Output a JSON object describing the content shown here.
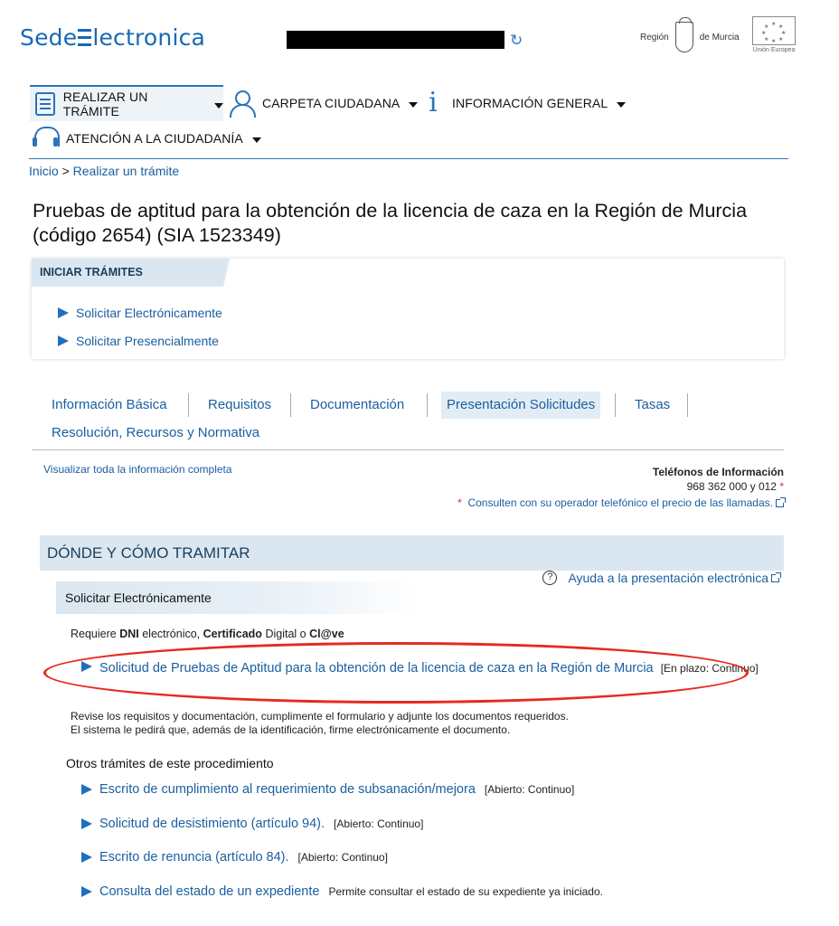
{
  "header": {
    "logo_text_before": "Sede",
    "logo_text_after": "lectronica",
    "region_label_left": "Región",
    "region_label_right": "de Murcia",
    "eu_caption": "Unión Europea"
  },
  "menu": {
    "items": [
      {
        "label": "REALIZAR UN TRÁMITE",
        "icon": "document-check-icon"
      },
      {
        "label": "CARPETA CIUDADANA",
        "icon": "user-icon"
      },
      {
        "label": "INFORMACIÓN GENERAL",
        "icon": "info-icon"
      },
      {
        "label": "ATENCIÓN A LA CIUDADANÍA",
        "icon": "headset-icon"
      }
    ]
  },
  "breadcrumb": {
    "home": "Inicio",
    "separator": ">",
    "current": "Realizar un trámite"
  },
  "page_title": "Pruebas de aptitud para la obtención de la licencia de caza en la Región de Murcia (código 2654) (SIA 1523349)",
  "iniciar": {
    "tab_label": "INICIAR TRÁMITES",
    "links": [
      "Solicitar Electrónicamente",
      "Solicitar Presencialmente"
    ]
  },
  "tabs": {
    "items": [
      "Información Básica",
      "Requisitos",
      "Documentación",
      "Presentación Solicitudes",
      "Tasas",
      "Resolución, Recursos y Normativa"
    ],
    "active": "Presentación Solicitudes"
  },
  "info": {
    "view_all": "Visualizar toda la información completa",
    "phones_title": "Teléfonos de Información",
    "phones": "968 362 000 y 012",
    "asterisk": "*",
    "note": "Consulten con su operador telefónico el precio de las llamadas."
  },
  "section": {
    "title": "DÓNDE Y CÓMO TRAMITAR",
    "help_link": "Ayuda a la presentación electrónica",
    "sub_title": "Solicitar Electrónicamente",
    "requiere_prefix": "Requiere",
    "requiere_dni": "DNI",
    "requiere_mid1": "electrónico,",
    "requiere_cert": "Certificado",
    "requiere_mid2": "Digital o",
    "requiere_clave": "Cl@ve",
    "main_link": "Solicitud de Pruebas de Aptitud para la obtención de la licencia de caza en la Región de Murcia",
    "main_status": "[En plazo: Continuo]",
    "revise_line1": "Revise los requisitos y documentación, cumplimente el formulario y adjunte los documentos requeridos.",
    "revise_line2": "El sistema le pedirá que, además de la identificación, firme electrónicamente el documento.",
    "otros_title": "Otros trámites de este procedimiento",
    "others": [
      {
        "label": "Escrito de cumplimiento al requerimiento de subsanación/mejora",
        "status": "[Abierto: Continuo]"
      },
      {
        "label": "Solicitud de desistimiento (artículo 94).",
        "status": "[Abierto: Continuo]"
      },
      {
        "label": "Escrito de renuncia (artículo 84).",
        "status": "[Abierto: Continuo]"
      },
      {
        "label": "Consulta del estado de un expediente",
        "status": "Permite consultar el estado de su expediente ya iniciado."
      }
    ]
  },
  "colors": {
    "accent": "#1a5fa0",
    "highlight_oval": "#e8291f",
    "tab_bg": "#dbe7f0"
  }
}
